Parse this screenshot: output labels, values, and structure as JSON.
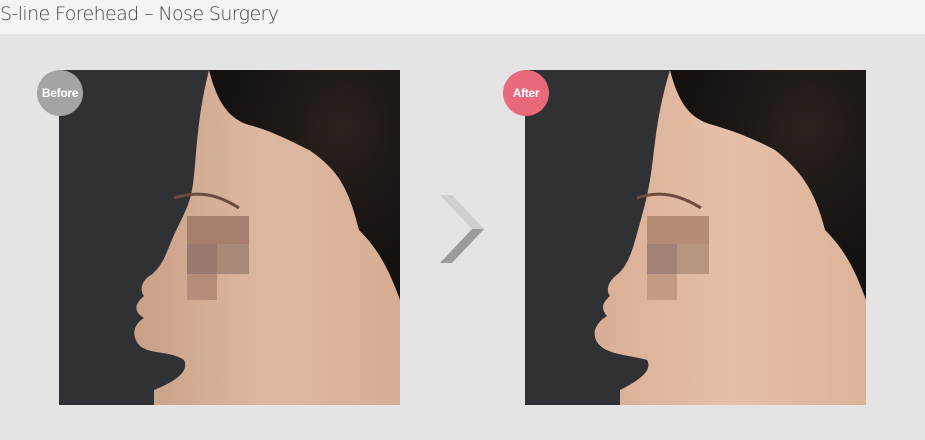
{
  "header": {
    "title": "S-line Forehead – Nose Surgery"
  },
  "comparison": {
    "before": {
      "badge_label": "Before",
      "badge_color": "#a4a4a4"
    },
    "after": {
      "badge_label": "After",
      "badge_color": "#e8697a"
    },
    "arrow_icon": "chevron-right-icon"
  }
}
